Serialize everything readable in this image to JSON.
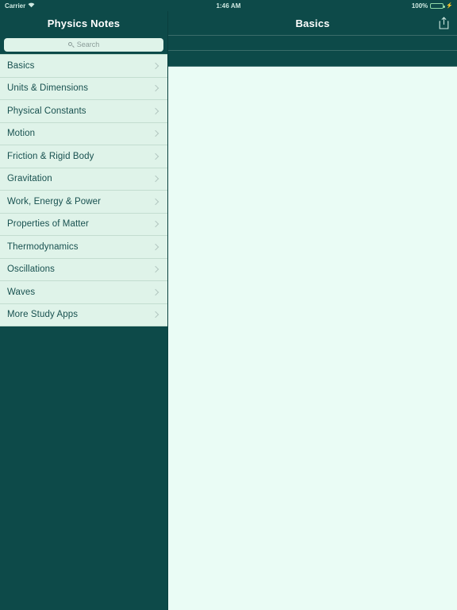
{
  "status_bar": {
    "carrier": "Carrier",
    "wifi_icon": "wifi-icon",
    "time": "1:46 AM",
    "battery_percent": "100%",
    "battery_icon": "battery-full-icon"
  },
  "sidebar": {
    "title": "Physics Notes",
    "search": {
      "placeholder": "Search",
      "value": "",
      "icon": "search-icon"
    },
    "items": [
      {
        "label": "Basics",
        "accessory": "chevron-right-icon"
      },
      {
        "label": "Units & Dimensions",
        "accessory": "chevron-right-icon"
      },
      {
        "label": "Physical Constants",
        "accessory": "chevron-right-icon"
      },
      {
        "label": "Motion",
        "accessory": "chevron-right-icon"
      },
      {
        "label": "Friction & Rigid Body",
        "accessory": "chevron-right-icon"
      },
      {
        "label": "Gravitation",
        "accessory": "chevron-right-icon"
      },
      {
        "label": "Work, Energy & Power",
        "accessory": "chevron-right-icon"
      },
      {
        "label": "Properties of Matter",
        "accessory": "chevron-right-icon"
      },
      {
        "label": "Thermodynamics",
        "accessory": "chevron-right-icon"
      },
      {
        "label": "Oscillations",
        "accessory": "chevron-right-icon"
      },
      {
        "label": "Waves",
        "accessory": "chevron-right-icon"
      },
      {
        "label": "More Study Apps",
        "accessory": "chevron-right-icon"
      }
    ]
  },
  "detail": {
    "title": "Basics",
    "share_icon": "share-icon",
    "band_one_text": "",
    "band_two_text": "",
    "content_text": ""
  },
  "colors": {
    "chrome_dark_teal": "#0d4a49",
    "row_mint": "#dff3e9",
    "content_pale_mint": "#eafcf5",
    "label_text": "#17504f",
    "chevron_gray": "#b3c7c0",
    "battery_green": "#45d977",
    "separator": "#3b6d6a"
  }
}
